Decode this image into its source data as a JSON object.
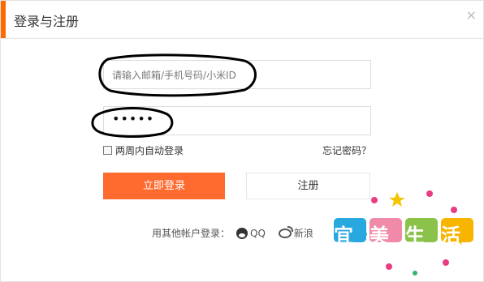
{
  "dialog": {
    "title": "登录与注册",
    "close_symbol": "×",
    "accent_color": "#ff6a00"
  },
  "form": {
    "account_placeholder": "请输入邮箱/手机号码/小米ID",
    "password_masked": "•••••",
    "remember_label": "两周内自动登录",
    "remember_checked": false,
    "forgot_label": "忘记密码？",
    "login_button": "立即登录",
    "login_button_color": "#ff6a2e",
    "register_button": "注册"
  },
  "social": {
    "label": "用其他帐户登录：",
    "providers": [
      {
        "name": "QQ",
        "icon": "qq-icon"
      },
      {
        "name": "新浪",
        "icon": "weibo-icon"
      }
    ]
  },
  "watermark": {
    "text": "宜美生活"
  }
}
